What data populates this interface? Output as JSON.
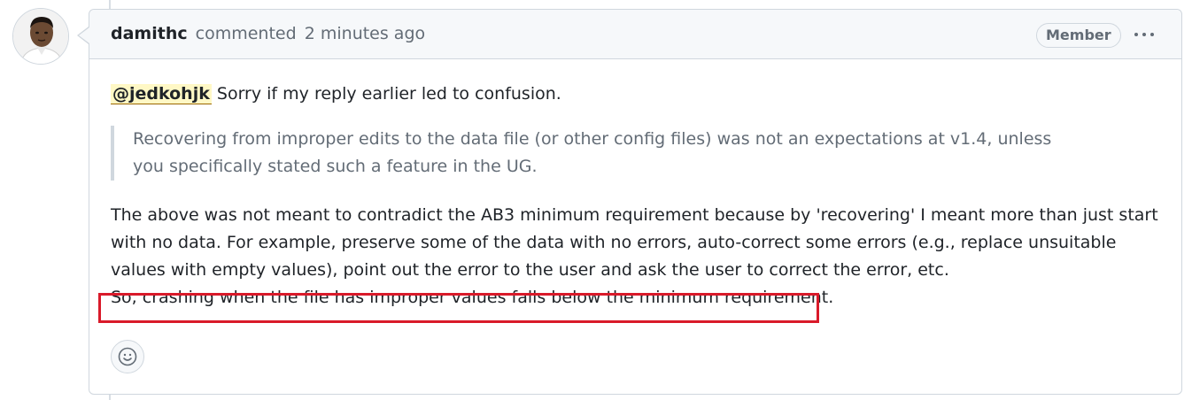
{
  "comment": {
    "author": "damithc",
    "action": "commented",
    "time": "2 minutes ago",
    "badge": "Member",
    "mention": "@jedkohjk",
    "first_line_rest": " Sorry if my reply earlier led to confusion.",
    "quote": "Recovering from improper edits to the data file (or other config files) was not an expectations at v1.4, unless you specifically stated such a feature in the UG.",
    "paragraph": "The above was not meant to contradict the AB3 minimum requirement because by 'recovering' I meant more than just start with no data. For example, preserve some of the data with no errors, auto-correct some errors (e.g., replace unsuitable values with empty values), point out the error to the user and ask the user to correct the error, etc.",
    "highlighted_line": "So, crashing when the file has improper values falls below the minimum requirement."
  },
  "icons": {
    "menu": "kebab-horizontal-icon",
    "reaction": "smiley-icon",
    "avatar": "avatar-image"
  },
  "colors": {
    "highlight_box": "#d91a2a",
    "mention_bg": "#fff8c5",
    "header_bg": "#f6f8fa"
  }
}
